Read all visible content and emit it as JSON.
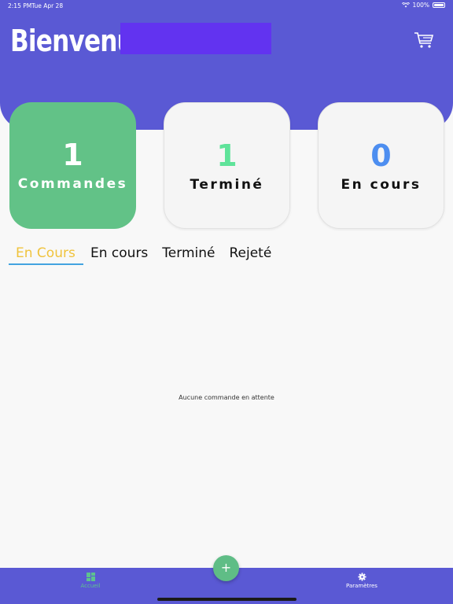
{
  "status_bar": {
    "time": "2:15 PM",
    "date": "Tue Apr 28",
    "battery": "100%"
  },
  "header": {
    "title": "Bienvenu",
    "cart_icon": "cart-icon"
  },
  "stats": [
    {
      "value": "1",
      "label": "Commandes"
    },
    {
      "value": "1",
      "label": "Terminé"
    },
    {
      "value": "0",
      "label": "En cours"
    }
  ],
  "tabs": [
    {
      "label": "En Cours"
    },
    {
      "label": "En cours"
    },
    {
      "label": "Terminé"
    },
    {
      "label": "Rejeté"
    }
  ],
  "empty_message": "Aucune commande en attente",
  "bottom_nav": {
    "home_label": "Accueil",
    "settings_label": "Paramètres",
    "fab_label": "+"
  },
  "colors": {
    "primary": "#5a59d4",
    "green": "#62c287",
    "active_tab": "#f0c33c",
    "tab_underline": "#43a4e0"
  }
}
